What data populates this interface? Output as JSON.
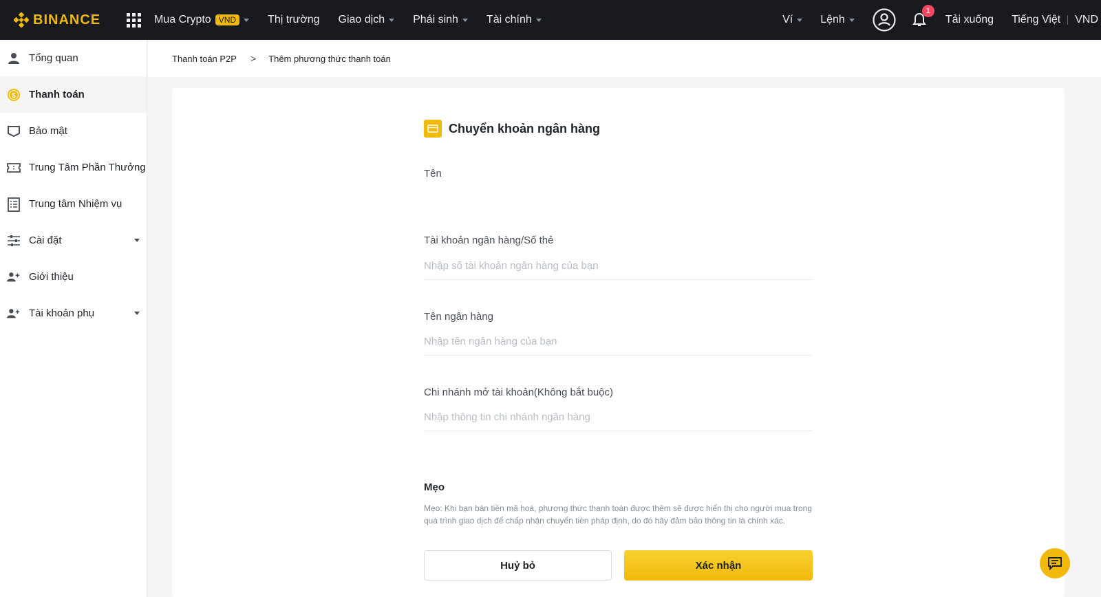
{
  "header": {
    "logo": "BINANCE",
    "nav": [
      {
        "label": "Mua Crypto",
        "badge": "VND",
        "dropdown": true
      },
      {
        "label": "Thị trường",
        "dropdown": false
      },
      {
        "label": "Giao dịch",
        "dropdown": true
      },
      {
        "label": "Phái sinh",
        "dropdown": true
      },
      {
        "label": "Tài chính",
        "dropdown": true
      }
    ],
    "right": {
      "wallet": "Ví",
      "orders": "Lệnh",
      "notification_count": "1",
      "download": "Tải xuống",
      "language": "Tiếng Việt",
      "currency": "VND"
    }
  },
  "sidebar": {
    "items": [
      {
        "label": "Tổng quan",
        "icon": "user-icon"
      },
      {
        "label": "Thanh toán",
        "icon": "dollar-coin-icon",
        "active": true
      },
      {
        "label": "Bảo mật",
        "icon": "shield-icon"
      },
      {
        "label": "Trung Tâm Phần Thưởng",
        "icon": "ticket-icon"
      },
      {
        "label": "Trung tâm Nhiệm vụ",
        "icon": "checklist-icon"
      },
      {
        "label": "Cài đặt",
        "icon": "sliders-icon",
        "dropdown": true
      },
      {
        "label": "Giới thiệu",
        "icon": "add-user-icon"
      },
      {
        "label": "Tài khoản phụ",
        "icon": "add-user-icon",
        "dropdown": true
      }
    ]
  },
  "breadcrumb": {
    "parent": "Thanh toán P2P",
    "current": "Thêm phương thức thanh toán"
  },
  "form": {
    "title": "Chuyển khoản ngân hàng",
    "fields": [
      {
        "label": "Tên",
        "value": "",
        "placeholder": ""
      },
      {
        "label": "Tài khoản ngân hàng/Số thẻ",
        "value": "",
        "placeholder": "Nhập số tài khoản ngân hàng của bạn"
      },
      {
        "label": "Tên ngân hàng",
        "value": "",
        "placeholder": "Nhập tên ngân hàng của bạn"
      },
      {
        "label": "Chi nhánh mở tài khoản(Không bắt buộc)",
        "value": "",
        "placeholder": "Nhập thông tin chi nhánh ngân hàng"
      }
    ],
    "tips_title": "Mẹo",
    "tips_text": "Mẹo: Khi bạn bán tiền mã hoá, phương thức thanh toán được thêm sẽ được hiển thị cho người mua trong quá trình giao dịch để chấp nhận chuyển tiền pháp định, do đó hãy đảm bảo thông tin là chính xác.",
    "cancel_label": "Huỷ bỏ",
    "confirm_label": "Xác nhận"
  },
  "colors": {
    "brand": "#f0b90b",
    "header_bg": "#181a20",
    "badge": "#f6465d"
  }
}
